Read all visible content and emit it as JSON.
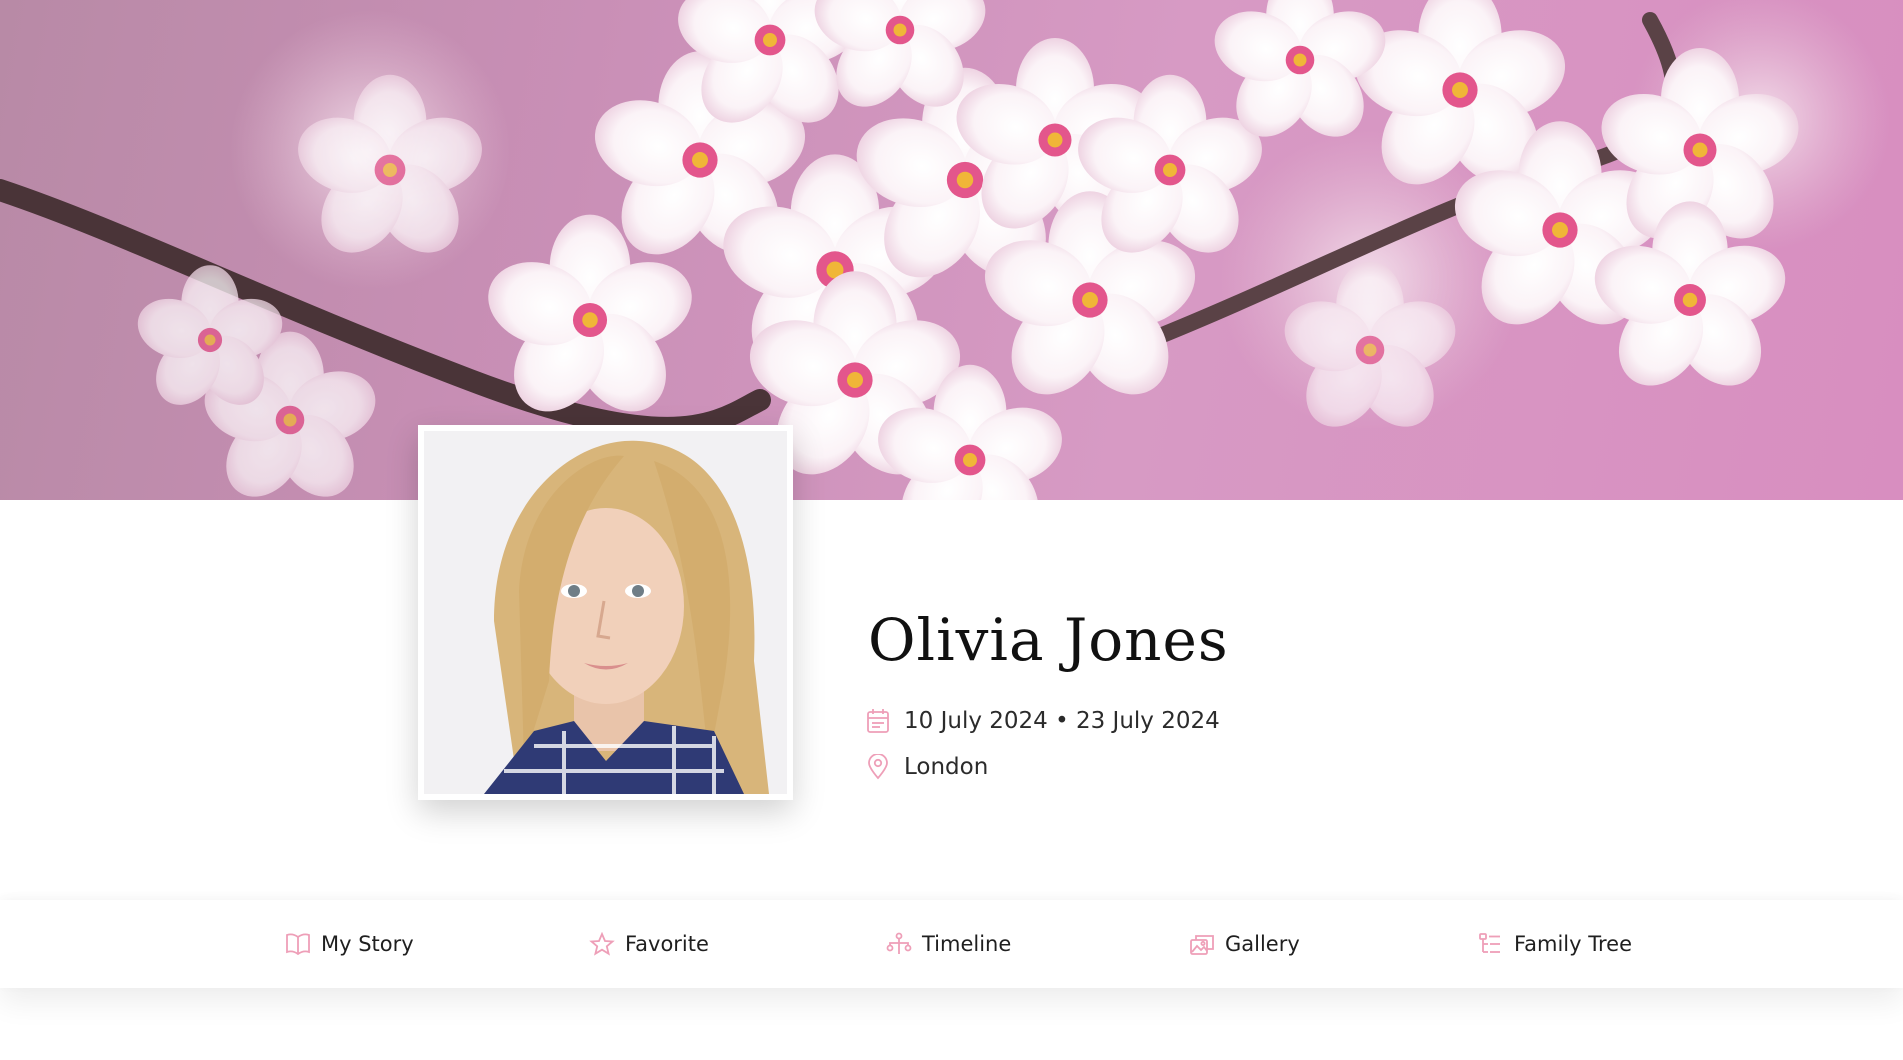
{
  "profile": {
    "name": "Olivia Jones",
    "dates": "10 July 2024 • 23 July 2024",
    "location": "London"
  },
  "nav": {
    "items": [
      {
        "label": "My Story",
        "icon": "book-icon"
      },
      {
        "label": "Favorite",
        "icon": "star-icon"
      },
      {
        "label": "Timeline",
        "icon": "timeline-icon"
      },
      {
        "label": "Gallery",
        "icon": "gallery-icon"
      },
      {
        "label": "Family Tree",
        "icon": "family-tree-icon"
      }
    ]
  },
  "theme": {
    "accent": "#ee9fb8",
    "hero_background": "#d79ac4"
  }
}
